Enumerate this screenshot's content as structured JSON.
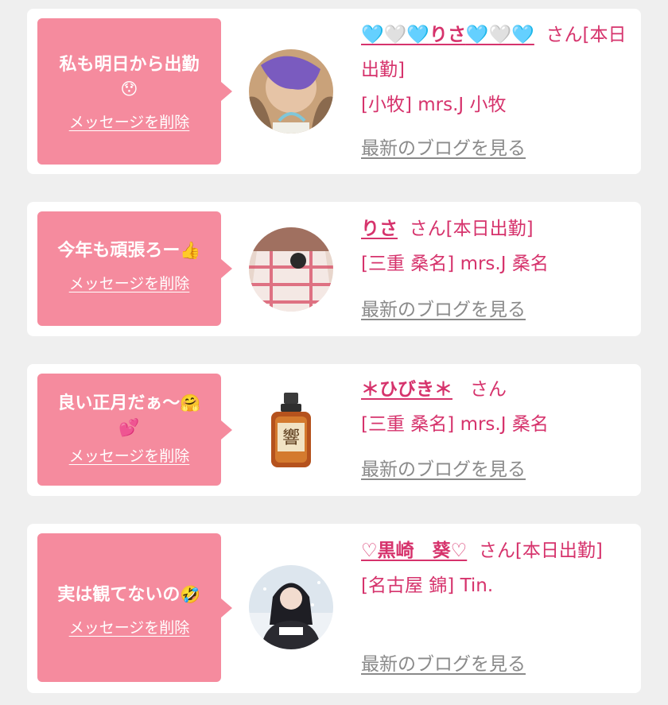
{
  "cards": [
    {
      "message_text": "私も明日から出勤",
      "message_emoji": "😯",
      "delete_label": "メッセージを削除",
      "name_prefix": "🩵🤍🩵",
      "name_main": "りさ",
      "name_suffix": "🩵🤍🩵",
      "honorific": "さん",
      "status": "[本日出勤]",
      "shop": "[小牧] mrs.J 小牧",
      "blog_label": "最新のブログを見る",
      "avatar_icon": "profile-photo-avatar"
    },
    {
      "message_text": "今年も頑張ろー",
      "message_emoji": "👍",
      "delete_label": "メッセージを削除",
      "name_main": "りさ",
      "honorific": "さん",
      "status": "[本日出勤]",
      "shop": "[三重 桑名] mrs.J 桑名",
      "blog_label": "最新のブログを見る",
      "avatar_icon": "profile-photo-avatar"
    },
    {
      "message_text": "良い正月だぁ〜",
      "message_emoji": "🤗",
      "message_emoji2": "💕",
      "delete_label": "メッセージを削除",
      "name_main": "＊ひびき＊",
      "honorific": "さん",
      "status": "",
      "shop": "[三重 桑名] mrs.J 桑名",
      "blog_label": "最新のブログを見る",
      "avatar_icon": "whisky-bottle-avatar"
    },
    {
      "message_text": "実は観てないの",
      "message_emoji": "🤣",
      "delete_label": "メッセージを削除",
      "name_main": "♡黒崎　葵♡",
      "honorific": "さん",
      "status": "[本日出勤]",
      "shop": "[名古屋 錦] Tin.",
      "blog_label": "最新のブログを見る",
      "avatar_icon": "profile-photo-avatar"
    }
  ],
  "colors": {
    "bubble": "#f58b9e",
    "accent_text": "#d6336c",
    "link_gray": "#8a8a8a",
    "page_bg": "#efefef"
  }
}
